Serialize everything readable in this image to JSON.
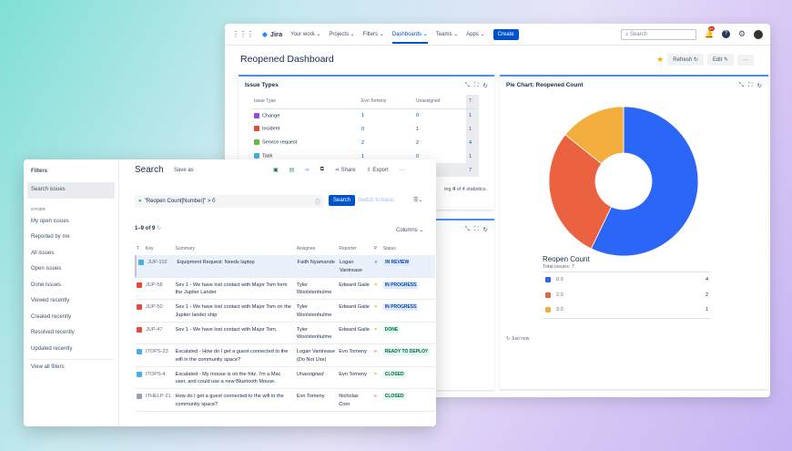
{
  "nav": {
    "app": "Jira",
    "items": [
      "Your work",
      "Projects",
      "Filters",
      "Dashboards",
      "Teams",
      "Apps"
    ],
    "active": "Dashboards",
    "create": "Create",
    "search_placeholder": "Search",
    "notif_badge": "9+"
  },
  "dashboard": {
    "title": "Reopened Dashboard",
    "refresh": "Refresh",
    "edit": "Edit",
    "more": "···"
  },
  "issue_types": {
    "title": "Issue Types",
    "headers": [
      "Issue Type",
      "Evn Tomeny",
      "Unassigned",
      "T:"
    ],
    "rows": [
      {
        "type": "Change",
        "color": "#904ee2",
        "a": "1",
        "u": "0",
        "t": "1"
      },
      {
        "type": "Incident",
        "color": "#e5493a",
        "a": "0",
        "u": "1",
        "t": "1"
      },
      {
        "type": "Service request",
        "color": "#63ba3c",
        "a": "2",
        "u": "2",
        "t": "4"
      },
      {
        "type": "Task",
        "color": "#4bade8",
        "a": "1",
        "u": "0",
        "t": "1"
      }
    ],
    "total": "7",
    "footer_pre": "ing ",
    "footer_n1": "4",
    "footer_mid": " of ",
    "footer_n2": "4",
    "footer_post": " statistics."
  },
  "pie": {
    "title": "Pie Chart: Reopened Count",
    "legend_title": "Reopen Count",
    "total_label": "Total issues: 7",
    "updated": "Just now",
    "slices": [
      {
        "label": "0.0",
        "value": 4,
        "color": "#2b66f6"
      },
      {
        "label": "2.0",
        "value": 2,
        "color": "#eb6240"
      },
      {
        "label": "3.0",
        "value": 1,
        "color": "#f3ae3d"
      }
    ]
  },
  "filters": {
    "title": "Filters",
    "search_issues": "Search issues",
    "other": "OTHER",
    "items": [
      "My open issues",
      "Reported by me",
      "All issues",
      "Open issues",
      "Done issues",
      "Viewed recently",
      "Created recently",
      "Resolved recently",
      "Updated recently"
    ],
    "view_all": "View all filters"
  },
  "search": {
    "title": "Search",
    "save_as": "Save as",
    "share": "Share",
    "export": "Export",
    "more": "···",
    "jql": "\"Reopen Count[Number]\" > 0",
    "search_btn": "Search",
    "switch": "Switch to basic",
    "count": "1–9 of 9",
    "columns": "Columns",
    "headers": [
      "T",
      "Key",
      "Summary",
      "Assignee",
      "Reporter",
      "P",
      "Status"
    ],
    "rows": [
      {
        "key": "JUP-102",
        "type_color": "#4bade8",
        "summary": "Equipment Request: Needs laptop",
        "assignee": "Faith Nyamande",
        "reporter": "Logan Vantrease",
        "prio": "»",
        "prio_color": "#2684ff",
        "status": "IN REVIEW",
        "status_style": "blue",
        "italic": false
      },
      {
        "key": "JUP-58",
        "type_color": "#e5493a",
        "summary": "Sev 1 - We have lost contact with Major Tom form the Jupiter Lander",
        "assignee": "Tyler Woolstenhulme",
        "reporter": "Edward Gaile",
        "prio": "=",
        "prio_color": "#ffab00",
        "status": "IN PROGRESS",
        "status_style": "blue",
        "italic": false
      },
      {
        "key": "JUP-50",
        "type_color": "#e5493a",
        "summary": "Sev 1 - We have lost contact with Major Tom on the Jupiter lander ship",
        "assignee": "Tyler Woolstenhulme",
        "reporter": "Edward Gaile",
        "prio": "=",
        "prio_color": "#ffab00",
        "status": "IN PROGRESS",
        "status_style": "blue",
        "italic": false
      },
      {
        "key": "JUP-47",
        "type_color": "#e5493a",
        "summary": "Sev 1 - We have lost contact with Major Tom.",
        "assignee": "Tyler Woolstenhulme",
        "reporter": "Edward Gaile",
        "prio": "=",
        "prio_color": "#ffab00",
        "status": "DONE",
        "status_style": "green",
        "italic": false
      },
      {
        "key": "ITOPS-23",
        "type_color": "#4bade8",
        "summary": "Escalated - How do I get a guest connected to the wifi in the community space?",
        "assignee": "Logan Vantrease (Do Not Use)",
        "reporter": "Evn Tomeny",
        "prio": "«",
        "prio_color": "#ff5630",
        "status": "READY TO DEPLOY",
        "status_style": "green",
        "italic": false
      },
      {
        "key": "ITOPS-4",
        "type_color": "#4bade8",
        "summary": "Escalated - My mouse is on the fritz. I'm a Mac user, and could use a new Bluetooth Mouse.",
        "assignee": "Unassigned",
        "reporter": "Evn Tomeny",
        "prio": "=",
        "prio_color": "#ffab00",
        "status": "CLOSED",
        "status_style": "green",
        "italic": true
      },
      {
        "key": "ITHELP-21",
        "type_color": "#97a0af",
        "summary": "How do I get a guest connected to the wifi in the community space?",
        "assignee": "Evn Tomeny",
        "reporter": "Nicholas Cron",
        "prio": "«",
        "prio_color": "#ff5630",
        "status": "CLOSED",
        "status_style": "green",
        "italic": false
      }
    ]
  }
}
